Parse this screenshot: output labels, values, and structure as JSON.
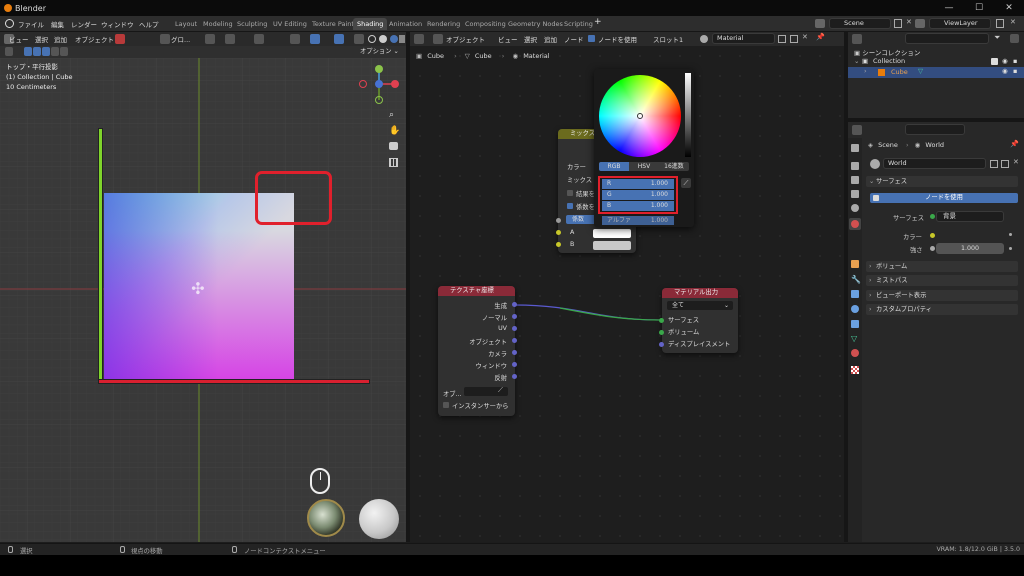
{
  "app": {
    "title": "Blender"
  },
  "menu": [
    "ファイル",
    "編集",
    "レンダー",
    "ウィンドウ",
    "ヘルプ"
  ],
  "workspace_tabs": [
    {
      "label": "Layout",
      "active": false
    },
    {
      "label": "Modeling",
      "active": false
    },
    {
      "label": "Sculpting",
      "active": false
    },
    {
      "label": "UV Editing",
      "active": false
    },
    {
      "label": "Texture Paint",
      "active": false
    },
    {
      "label": "Shading",
      "active": true
    },
    {
      "label": "Animation",
      "active": false
    },
    {
      "label": "Rendering",
      "active": false
    },
    {
      "label": "Compositing",
      "active": false
    },
    {
      "label": "Geometry Nodes",
      "active": false
    },
    {
      "label": "Scripting",
      "active": false
    }
  ],
  "scene": {
    "name": "Scene",
    "viewlayer": "ViewLayer"
  },
  "viewport": {
    "menu": [
      "ビュー",
      "選択",
      "追加",
      "オブジェクト"
    ],
    "transform": "グロ...",
    "options": "オプション",
    "info": [
      "トップ・平行投影",
      "(1) Collection | Cube",
      "10 Centimeters"
    ],
    "gizmo": {
      "z": "Z",
      "x": "X",
      "y": "Y"
    }
  },
  "node_editor": {
    "mode": "オブジェクト",
    "menu": [
      "ビュー",
      "選択",
      "追加",
      "ノード"
    ],
    "use_nodes": "ノードを使用",
    "slot": "スロット1",
    "material": "Material",
    "breadcrumb": [
      "Cube",
      "Cube",
      "Material"
    ],
    "mix_node": {
      "title": "ミックス",
      "rows": [
        "カラー",
        "ミックス",
        "結果を",
        "係数を",
        "係数",
        "A",
        "B"
      ],
      "alpha_label": "アルファ",
      "alpha_value": "1.000"
    },
    "texcoord_node": {
      "title": "テクスチャ座標",
      "outputs": [
        "生成",
        "ノーマル",
        "UV",
        "オブジェクト",
        "カメラ",
        "ウィンドウ",
        "反射"
      ],
      "object_label": "オブ...",
      "instancer": "インスタンサーから"
    },
    "output_node": {
      "title": "マテリアル出力",
      "target": "全て",
      "inputs": [
        "サーフェス",
        "ボリューム",
        "ディスプレイスメント"
      ]
    }
  },
  "color_picker": {
    "modes": [
      "RGB",
      "HSV",
      "16進数"
    ],
    "active_mode": "RGB",
    "channels": [
      {
        "label": "R",
        "value": "1.000"
      },
      {
        "label": "G",
        "value": "1.000"
      },
      {
        "label": "B",
        "value": "1.000"
      }
    ]
  },
  "outliner": {
    "root": "シーンコレクション",
    "collection": "Collection",
    "object": "Cube"
  },
  "properties": {
    "breadcrumb": [
      "Scene",
      "World"
    ],
    "world": "World",
    "surface_panel": "サーフェス",
    "use_nodes_btn": "ノードを使用",
    "surface_label": "サーフェス",
    "surface_value": "背景",
    "color_label": "カラー",
    "strength_label": "強さ",
    "strength_value": "1.000",
    "panels": [
      "ボリューム",
      "ミストパス",
      "ビューポート表示",
      "カスタムプロパティ"
    ]
  },
  "status": {
    "select": "選択",
    "rotate": "視点の移動",
    "context": "ノードコンテクストメニュー",
    "vram": "VRAM: 1.8/12.0 GiB | 3.5.0"
  },
  "colors": {
    "accent": "#4772b3",
    "select_red": "#e0202c",
    "x_axis": "#c72233",
    "y_axis": "#7fd42b"
  }
}
